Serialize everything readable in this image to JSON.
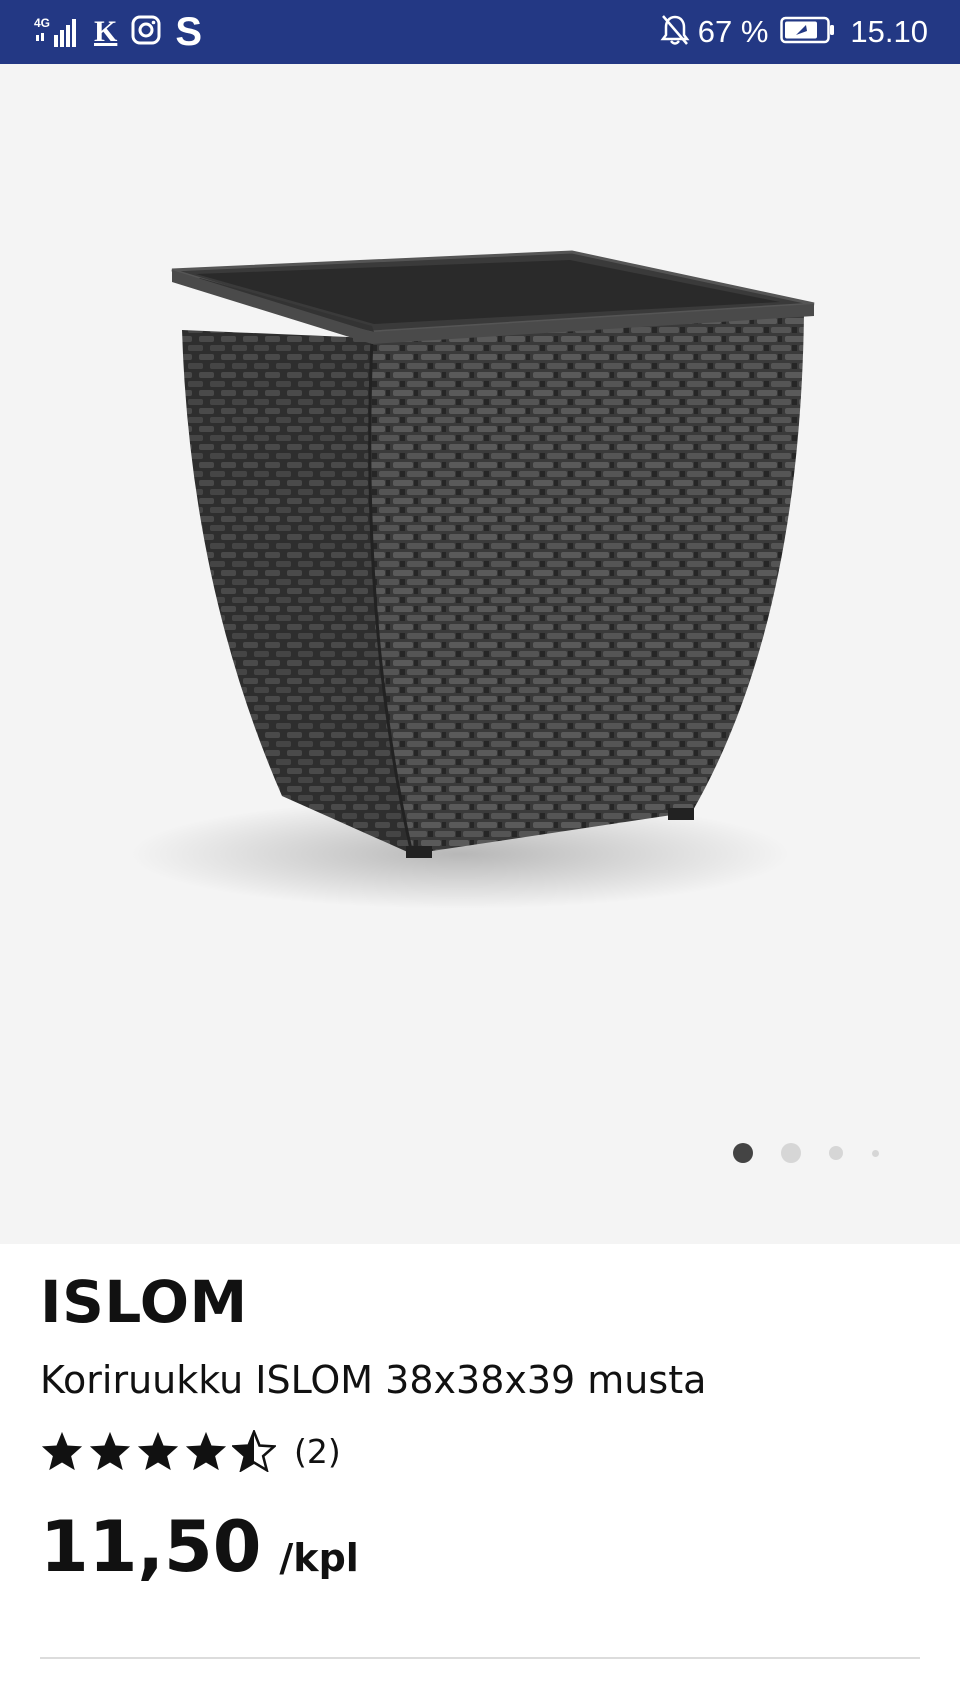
{
  "status_bar": {
    "network": "4G",
    "app_icon_k": "K",
    "app_icon_s": "S",
    "battery": "67 %",
    "time": "15.10",
    "icons": [
      "signal-icon",
      "instagram-icon",
      "bell-off-icon",
      "battery-icon"
    ]
  },
  "gallery": {
    "image_description": "product-photo-wicker-planter",
    "page_count": 4,
    "active_page": 1
  },
  "product": {
    "brand": "ISLOM",
    "description": "Koriruukku ISLOM 38x38x39 musta",
    "rating": {
      "stars": 4.5,
      "max": 5,
      "count": "(2)"
    },
    "price": "11,50",
    "unit": "/kpl"
  },
  "colors": {
    "status_bar": "#233884",
    "image_bg": "#f4f4f4",
    "text": "#111111"
  }
}
